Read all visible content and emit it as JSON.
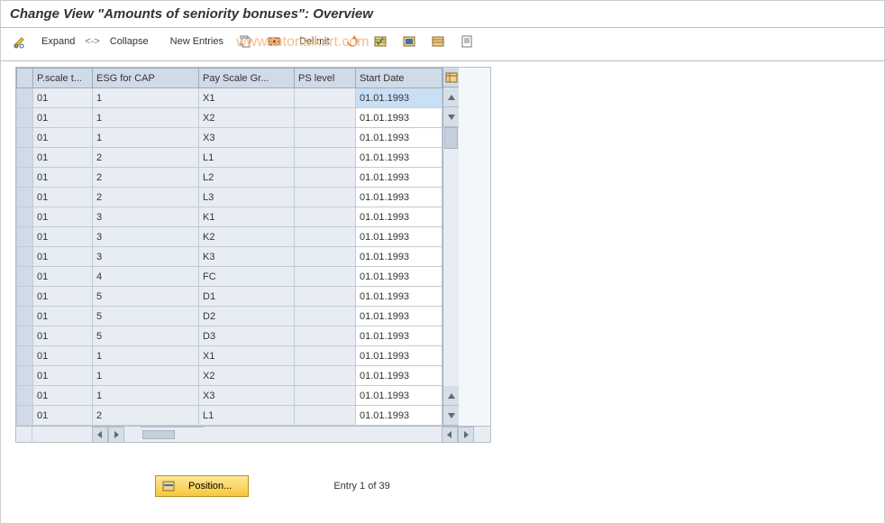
{
  "title": "Change View \"Amounts of seniority bonuses\": Overview",
  "watermark": "www.tutorialkart.com",
  "toolbar": {
    "expand": "Expand",
    "colsep": "<->",
    "collapse": "Collapse",
    "new_entries": "New Entries",
    "delimit": "Delimit"
  },
  "columns": {
    "sel": "",
    "pscale": "P.scale t...",
    "esg": "ESG for CAP",
    "psg": "Pay Scale Gr...",
    "psl": "PS level",
    "start": "Start Date"
  },
  "rows": [
    {
      "pscale": "01",
      "esg": "1",
      "psg": "X1",
      "psl": "",
      "start": "01.01.1993"
    },
    {
      "pscale": "01",
      "esg": "1",
      "psg": "X2",
      "psl": "",
      "start": "01.01.1993"
    },
    {
      "pscale": "01",
      "esg": "1",
      "psg": "X3",
      "psl": "",
      "start": "01.01.1993"
    },
    {
      "pscale": "01",
      "esg": "2",
      "psg": "L1",
      "psl": "",
      "start": "01.01.1993"
    },
    {
      "pscale": "01",
      "esg": "2",
      "psg": "L2",
      "psl": "",
      "start": "01.01.1993"
    },
    {
      "pscale": "01",
      "esg": "2",
      "psg": "L3",
      "psl": "",
      "start": "01.01.1993"
    },
    {
      "pscale": "01",
      "esg": "3",
      "psg": "K1",
      "psl": "",
      "start": "01.01.1993"
    },
    {
      "pscale": "01",
      "esg": "3",
      "psg": "K2",
      "psl": "",
      "start": "01.01.1993"
    },
    {
      "pscale": "01",
      "esg": "3",
      "psg": "K3",
      "psl": "",
      "start": "01.01.1993"
    },
    {
      "pscale": "01",
      "esg": "4",
      "psg": "FC",
      "psl": "",
      "start": "01.01.1993"
    },
    {
      "pscale": "01",
      "esg": "5",
      "psg": "D1",
      "psl": "",
      "start": "01.01.1993"
    },
    {
      "pscale": "01",
      "esg": "5",
      "psg": "D2",
      "psl": "",
      "start": "01.01.1993"
    },
    {
      "pscale": "01",
      "esg": "5",
      "psg": "D3",
      "psl": "",
      "start": "01.01.1993"
    },
    {
      "pscale": "01",
      "esg": "1",
      "psg": "X1",
      "psl": "",
      "start": "01.01.1993"
    },
    {
      "pscale": "01",
      "esg": "1",
      "psg": "X2",
      "psl": "",
      "start": "01.01.1993"
    },
    {
      "pscale": "01",
      "esg": "1",
      "psg": "X3",
      "psl": "",
      "start": "01.01.1993"
    },
    {
      "pscale": "01",
      "esg": "2",
      "psg": "L1",
      "psl": "",
      "start": "01.01.1993"
    }
  ],
  "footer": {
    "position_label": "Position...",
    "entry_text": "Entry 1 of 39"
  }
}
